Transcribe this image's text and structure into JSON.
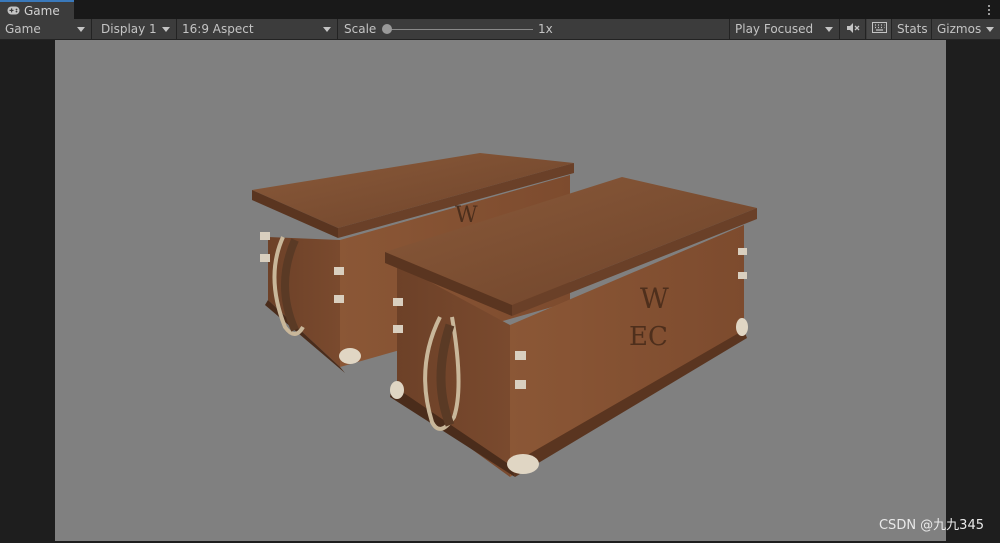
{
  "tab": {
    "label": "Game",
    "icon": "gamepad-icon"
  },
  "toolbar": {
    "view_mode": "Game",
    "display": "Display 1",
    "aspect": "16:9 Aspect",
    "scale_label": "Scale",
    "scale_value": "1x",
    "play_mode": "Play Focused",
    "stats_label": "Stats",
    "gizmos_label": "Gizmos"
  },
  "scene": {
    "chest_marking_top": "W",
    "chest_marking_bottom": "EC"
  },
  "watermark": "CSDN @九九345",
  "colors": {
    "accent": "#3a79bb",
    "viewport": "#808080",
    "toolbar": "#3c3c3c",
    "wood": "#7b4a2c"
  }
}
